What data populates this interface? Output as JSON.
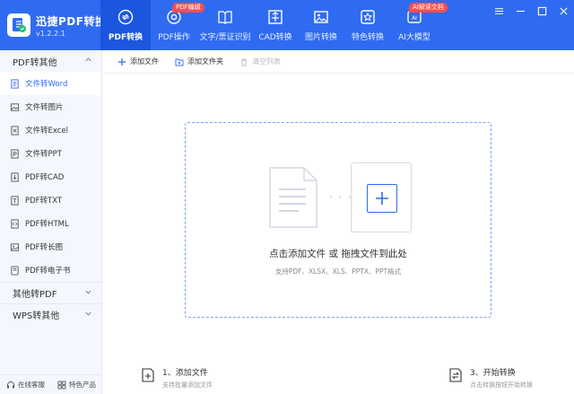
{
  "app": {
    "name": "迅捷PDF转换器",
    "version": "v1.2.2.1"
  },
  "nav": [
    {
      "label": "PDF转换",
      "icon": "convert-icon",
      "active": true,
      "badge": ""
    },
    {
      "label": "PDF操作",
      "icon": "gear-icon",
      "active": false,
      "badge": "PDF编辑"
    },
    {
      "label": "文字/票证识别",
      "icon": "book-icon",
      "active": false,
      "badge": ""
    },
    {
      "label": "CAD转换",
      "icon": "cad-icon",
      "active": false,
      "badge": ""
    },
    {
      "label": "图片转换",
      "icon": "image-icon",
      "active": false,
      "badge": ""
    },
    {
      "label": "特色转换",
      "icon": "star-icon",
      "active": false,
      "badge": ""
    },
    {
      "label": "AI大模型",
      "icon": "ai-icon",
      "active": false,
      "badge": "AI解读文档"
    }
  ],
  "sidebar": {
    "groups": [
      {
        "label": "PDF转其他",
        "expanded": true,
        "items": [
          {
            "label": "文件转Word",
            "icon": "word-icon",
            "active": true
          },
          {
            "label": "文件转图片",
            "icon": "image-icon",
            "active": false
          },
          {
            "label": "文件转Excel",
            "icon": "excel-icon",
            "active": false
          },
          {
            "label": "文件转PPT",
            "icon": "ppt-icon",
            "active": false
          },
          {
            "label": "PDF转CAD",
            "icon": "cad-icon",
            "active": false
          },
          {
            "label": "PDF转TXT",
            "icon": "txt-icon",
            "active": false
          },
          {
            "label": "PDF转HTML",
            "icon": "html-icon",
            "active": false
          },
          {
            "label": "PDF转长图",
            "icon": "long-image-icon",
            "active": false
          },
          {
            "label": "PDF转电子书",
            "icon": "ebook-icon",
            "active": false
          }
        ]
      },
      {
        "label": "其他转PDF",
        "expanded": false,
        "items": []
      },
      {
        "label": "WPS转其他",
        "expanded": false,
        "items": []
      }
    ],
    "footer": [
      {
        "label": "在线客服",
        "icon": "headset-icon"
      },
      {
        "label": "特色产品",
        "icon": "grid-icon"
      }
    ]
  },
  "toolbar": {
    "add_file": "添加文件",
    "add_folder": "添加文件夹",
    "clear_list": "清空列表"
  },
  "dropzone": {
    "title": "点击添加文件 或 拖拽文件到此处",
    "subtitle": "支持PDF、XLSX、XLS、PPTX、PPT格式",
    "arrow": "› › ›"
  },
  "steps": [
    {
      "title": "1、添加文件",
      "desc": "支持批量添加文件"
    },
    {
      "title": "3、开始转换",
      "desc": "点击转换按钮开始转换"
    }
  ],
  "colors": {
    "accent": "#2f6bf0",
    "accent_dark": "#1a56de",
    "badge": "#ff4d4f",
    "sidebar_bg": "#f4f7fd"
  }
}
